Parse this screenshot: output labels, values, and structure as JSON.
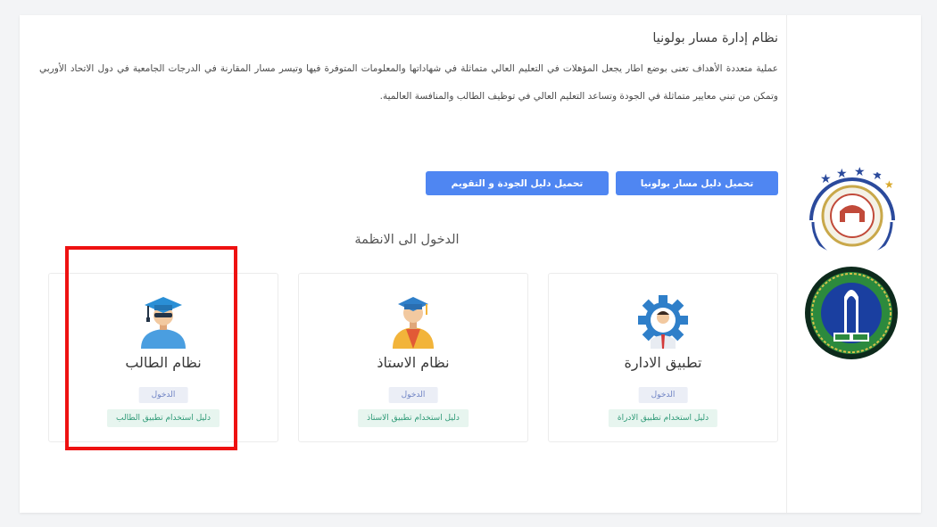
{
  "header": {
    "title": "نظام إدارة مسار بولونيا",
    "description": "عملية متعددة الأهداف تعنى بوضع اطار يجعل المؤهلات في التعليم العالي متماثلة في شهاداتها والمعلومات المتوفرة فيها وتيسر مسار المقارنة في الدرجات الجامعية في دول الاتحاد الأوربي وتمكن من تبني معايير متماثلة في الجودة وتساعد التعليم العالي في توظيف الطالب والمنافسة العالمية."
  },
  "downloads": {
    "bologna_label": "تحميل دليل مسار بولونيا",
    "quality_label": "تحميل دليل الجودة و التقويم"
  },
  "systems": {
    "section_title": "الدخول الى الانظمة",
    "cards": [
      {
        "title": "تطبيق الادارة",
        "login": "الدخول",
        "guide": "دليل استخدام تطبيق الادراة",
        "icon": "admin-gear-icon"
      },
      {
        "title": "نظام الاستاذ",
        "login": "الدخول",
        "guide": "دليل استخدام تطبيق الاستاذ",
        "icon": "professor-icon"
      },
      {
        "title": "نظام الطالب",
        "login": "الدخول",
        "guide": "دليل استخدام تطبيق الطالب",
        "icon": "student-icon"
      }
    ]
  },
  "colors": {
    "primary_button": "#4f86f2",
    "highlight": "#ee1111",
    "guide_text": "#2f9a77"
  }
}
